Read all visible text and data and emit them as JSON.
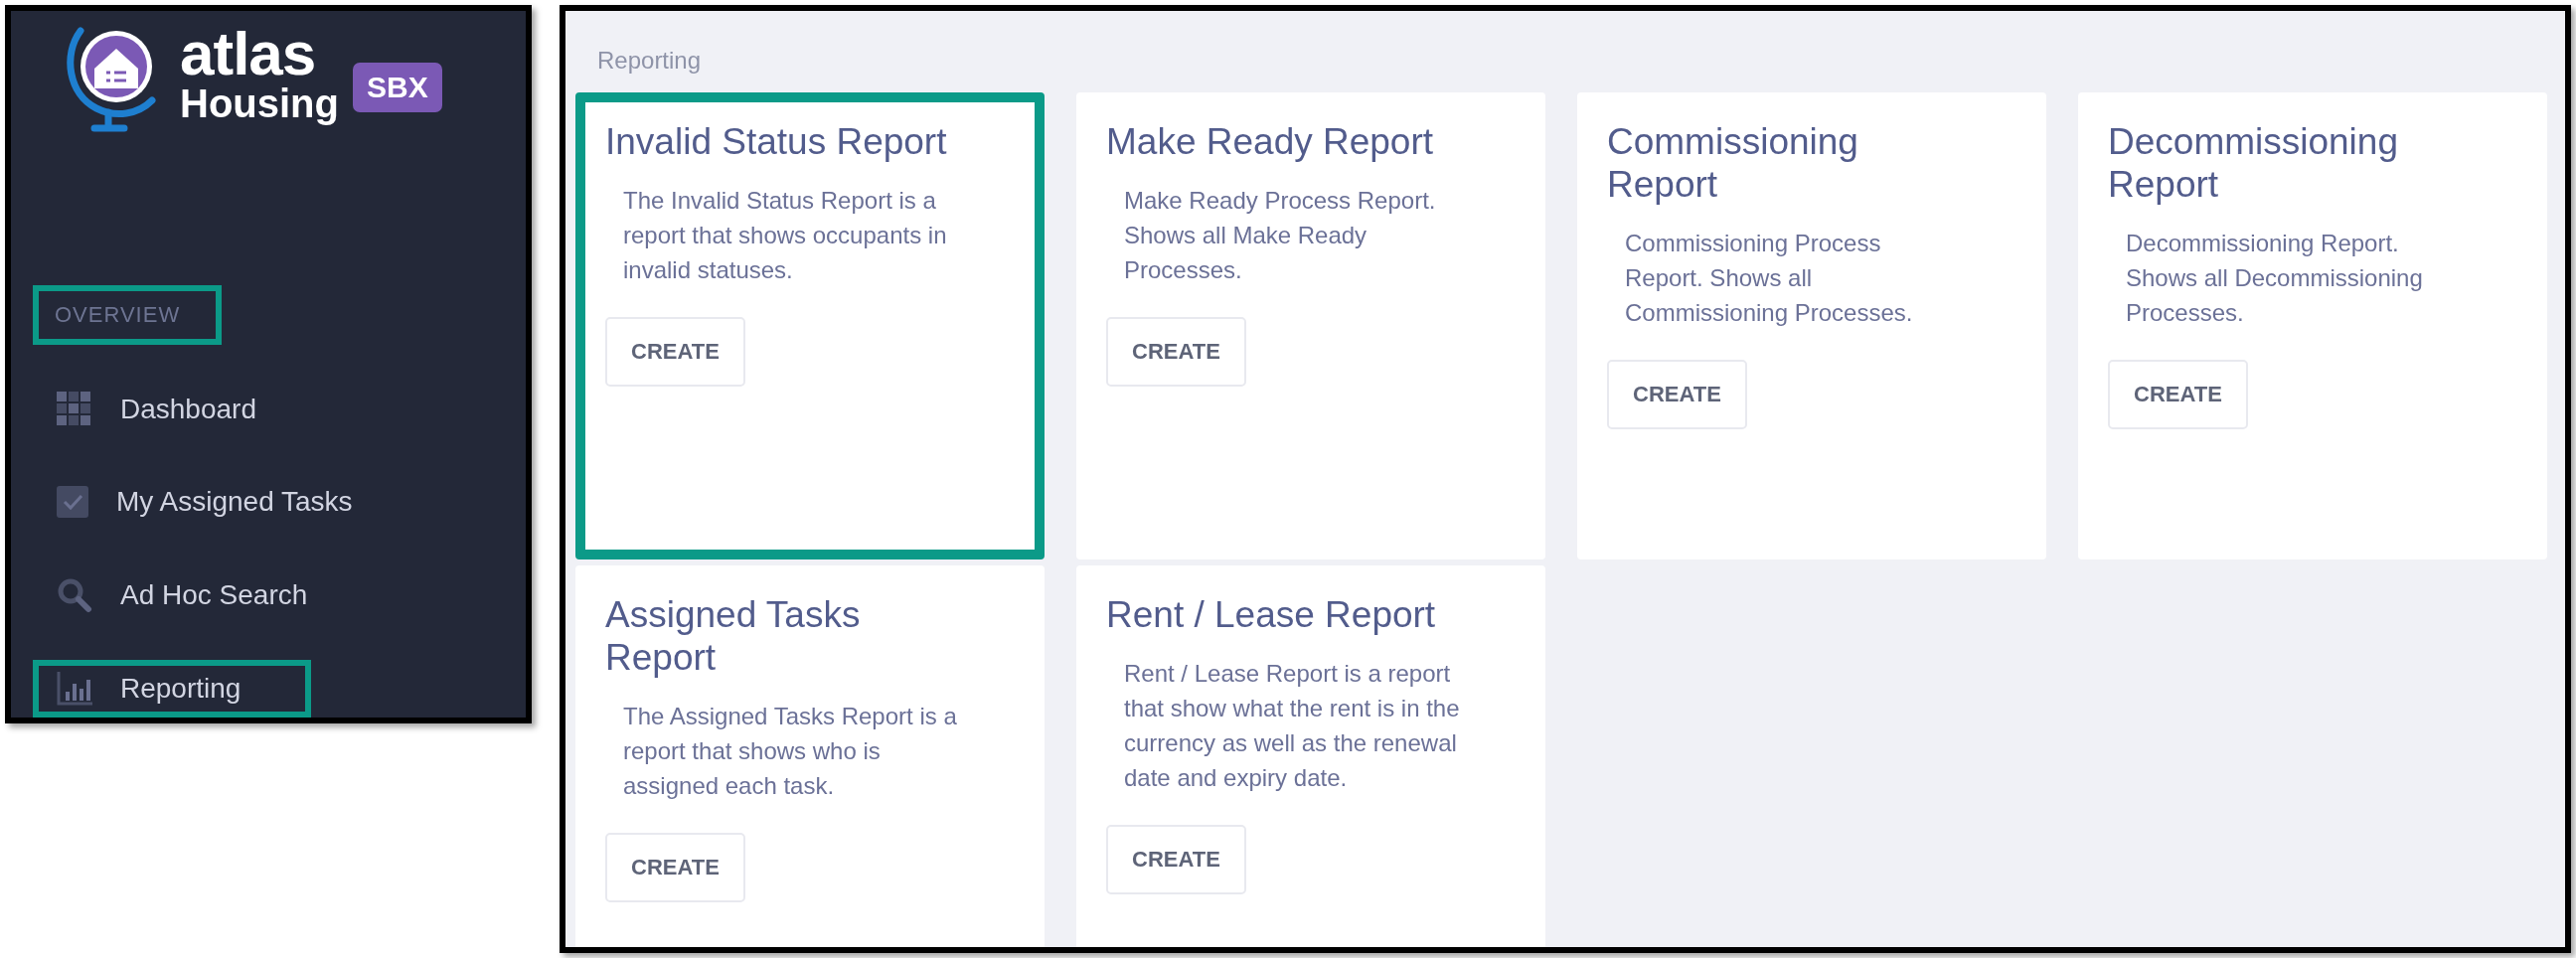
{
  "sidebar": {
    "logo": {
      "word": "atlas",
      "subword": "Housing",
      "badge": "SBX"
    },
    "section": {
      "label": "OVERVIEW",
      "highlighted": true
    },
    "items": [
      {
        "label": "Dashboard",
        "highlighted": false
      },
      {
        "label": "My Assigned Tasks",
        "highlighted": false
      },
      {
        "label": "Ad Hoc Search",
        "highlighted": false
      },
      {
        "label": "Reporting",
        "highlighted": true
      }
    ]
  },
  "page": {
    "title": "Reporting",
    "cards": [
      {
        "title": "Invalid Status Report",
        "description": "The Invalid Status Report is a report that shows occupants in invalid statuses.",
        "button": "CREATE",
        "highlighted": true
      },
      {
        "title": "Make Ready Report",
        "description": "Make Ready Process Report. Shows all Make Ready Processes.",
        "button": "CREATE",
        "highlighted": false
      },
      {
        "title": "Commissioning Report",
        "description": "Commissioning Process Report. Shows all Commissioning Processes.",
        "button": "CREATE",
        "highlighted": false
      },
      {
        "title": "Decommissioning Report",
        "description": "Decommissioning Report. Shows all Decommissioning Processes.",
        "button": "CREATE",
        "highlighted": false
      },
      {
        "title": "Assigned Tasks Report",
        "description": "The Assigned Tasks Report is a report that shows who is assigned each task.",
        "button": "CREATE",
        "highlighted": false
      },
      {
        "title": "Rent / Lease Report",
        "description": "Rent / Lease Report is a report that show what the rent is in the currency as well as the renewal date and expiry date.",
        "button": "CREATE",
        "highlighted": false
      }
    ]
  }
}
